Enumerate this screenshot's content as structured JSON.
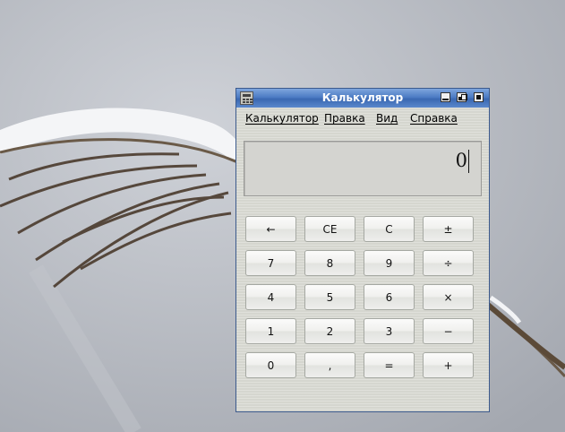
{
  "window": {
    "title": "Калькулятор"
  },
  "menu": [
    {
      "label": "Калькулятор"
    },
    {
      "label": "Правка"
    },
    {
      "label": "Вид"
    },
    {
      "label": "Справка"
    }
  ],
  "display": {
    "value": "0"
  },
  "keys": [
    {
      "label": "←",
      "name": "backspace-button"
    },
    {
      "label": "CE",
      "name": "clear-entry-button"
    },
    {
      "label": "C",
      "name": "clear-button"
    },
    {
      "label": "±",
      "name": "sign-toggle-button"
    },
    {
      "label": "7",
      "name": "digit-7-button"
    },
    {
      "label": "8",
      "name": "digit-8-button"
    },
    {
      "label": "9",
      "name": "digit-9-button"
    },
    {
      "label": "÷",
      "name": "divide-button"
    },
    {
      "label": "4",
      "name": "digit-4-button"
    },
    {
      "label": "5",
      "name": "digit-5-button"
    },
    {
      "label": "6",
      "name": "digit-6-button"
    },
    {
      "label": "×",
      "name": "multiply-button"
    },
    {
      "label": "1",
      "name": "digit-1-button"
    },
    {
      "label": "2",
      "name": "digit-2-button"
    },
    {
      "label": "3",
      "name": "digit-3-button"
    },
    {
      "label": "−",
      "name": "subtract-button"
    },
    {
      "label": "0",
      "name": "digit-0-button"
    },
    {
      "label": ",",
      "name": "decimal-button"
    },
    {
      "label": "=",
      "name": "equals-button"
    },
    {
      "label": "+",
      "name": "add-button"
    }
  ],
  "icons": {
    "app": "calculator-icon",
    "minimize": "minimize-icon",
    "maximize": "maximize-icon",
    "close": "close-icon"
  },
  "colors": {
    "titlebar": "#4d7cc4",
    "window_body": "#d9dad3",
    "display_bg": "#d4d4d0"
  }
}
